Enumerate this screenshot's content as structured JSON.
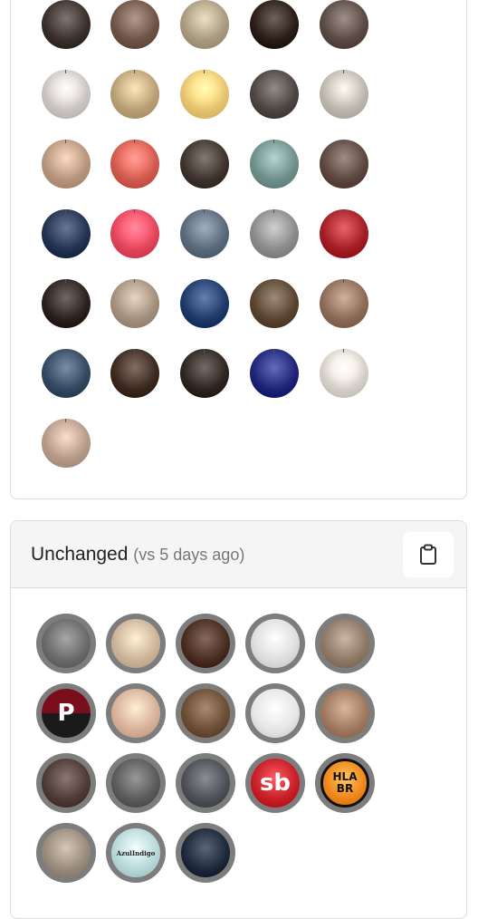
{
  "accent_colors": {
    "ring": "#7d7d7d",
    "border": "#dcdcdc",
    "header_bg": "#f5f5f5"
  },
  "top_section": {
    "avatars": [
      {
        "name": "profile-avatar-1",
        "color": "#3b2f2b"
      },
      {
        "name": "profile-avatar-2",
        "color": "#6d5446"
      },
      {
        "name": "profile-avatar-3",
        "color": "#a89a7e"
      },
      {
        "name": "profile-avatar-4",
        "color": "#2a1d17"
      },
      {
        "name": "profile-avatar-5",
        "color": "#5a4a44"
      },
      {
        "name": "profile-avatar-6",
        "color": "#c9c4c2"
      },
      {
        "name": "profile-avatar-7",
        "color": "#b9a074"
      },
      {
        "name": "profile-avatar-8",
        "color": "#e6c370"
      },
      {
        "name": "profile-avatar-9",
        "color": "#4d4542"
      },
      {
        "name": "profile-avatar-10",
        "color": "#bdb6ad"
      },
      {
        "name": "profile-avatar-11",
        "color": "#b7957c"
      },
      {
        "name": "profile-avatar-12",
        "color": "#d15a4f"
      },
      {
        "name": "profile-avatar-13",
        "color": "#3e342d"
      },
      {
        "name": "profile-avatar-14",
        "color": "#6e8f8a"
      },
      {
        "name": "profile-avatar-15",
        "color": "#5b4740"
      },
      {
        "name": "profile-avatar-16",
        "color": "#22324f"
      },
      {
        "name": "profile-avatar-17",
        "color": "#e0455b"
      },
      {
        "name": "profile-avatar-18",
        "color": "#59697a"
      },
      {
        "name": "profile-avatar-19",
        "color": "#8a8a8a"
      },
      {
        "name": "profile-avatar-20",
        "color": "#a31e24"
      },
      {
        "name": "profile-avatar-21",
        "color": "#2c211e"
      },
      {
        "name": "profile-avatar-22",
        "color": "#a2907c"
      },
      {
        "name": "profile-avatar-23",
        "color": "#1f3a68"
      },
      {
        "name": "profile-avatar-24",
        "color": "#584431"
      },
      {
        "name": "profile-avatar-25",
        "color": "#8b6a58"
      },
      {
        "name": "profile-avatar-26",
        "color": "#34495f"
      },
      {
        "name": "profile-avatar-27",
        "color": "#3c2a20"
      },
      {
        "name": "profile-avatar-28",
        "color": "#2f2521"
      },
      {
        "name": "profile-avatar-29",
        "color": "#1e2476"
      },
      {
        "name": "profile-avatar-30",
        "color": "#d5cfca"
      },
      {
        "name": "profile-avatar-31",
        "color": "#b59a88"
      }
    ]
  },
  "unchanged_section": {
    "title": "Unchanged",
    "subtitle": "(vs 5 days ago)",
    "copy_icon": "clipboard-icon",
    "avatars": [
      {
        "name": "unchanged-avatar-1",
        "color": "#6b6b6b"
      },
      {
        "name": "unchanged-avatar-2",
        "color": "#cdb59a"
      },
      {
        "name": "unchanged-avatar-3",
        "color": "#4a2e22"
      },
      {
        "name": "unchanged-avatar-4",
        "color": "#dfdfdf"
      },
      {
        "name": "unchanged-avatar-5",
        "color": "#8e7a66"
      },
      {
        "name": "unchanged-avatar-6",
        "color": "#7a0e1c",
        "logo": "P"
      },
      {
        "name": "unchanged-avatar-7",
        "color": "#d8b299"
      },
      {
        "name": "unchanged-avatar-8",
        "color": "#6d4f36"
      },
      {
        "name": "unchanged-avatar-9",
        "color": "#e9e6e8"
      },
      {
        "name": "unchanged-avatar-10",
        "color": "#a07a60"
      },
      {
        "name": "unchanged-avatar-11",
        "color": "#4f3c36"
      },
      {
        "name": "unchanged-avatar-12",
        "color": "#5c5c5c"
      },
      {
        "name": "unchanged-avatar-13",
        "color": "#4e5258"
      },
      {
        "name": "unchanged-avatar-14",
        "color": "#c91f27",
        "logo": "sb"
      },
      {
        "name": "unchanged-avatar-15",
        "color": "#f08a1e",
        "logo": "HLA BR"
      },
      {
        "name": "unchanged-avatar-16",
        "color": "#9a8c7c"
      },
      {
        "name": "unchanged-avatar-17",
        "color": "#b8d9d9",
        "logo": "AzulIndigo"
      },
      {
        "name": "unchanged-avatar-18",
        "color": "#1f2a3c"
      }
    ]
  }
}
